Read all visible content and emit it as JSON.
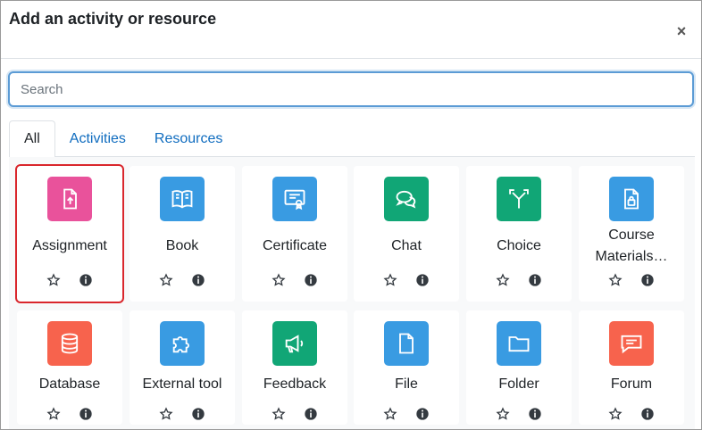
{
  "modal": {
    "title": "Add an activity or resource",
    "close_label": "×"
  },
  "search": {
    "placeholder": "Search",
    "value": ""
  },
  "tabs": [
    {
      "label": "All",
      "active": true
    },
    {
      "label": "Activities",
      "active": false
    },
    {
      "label": "Resources",
      "active": false
    }
  ],
  "items": [
    {
      "label": "Assignment",
      "icon": "assignment-upload-icon",
      "color": "#e9529b",
      "selected": true
    },
    {
      "label": "Book",
      "icon": "book-icon",
      "color": "#399be2"
    },
    {
      "label": "Certificate",
      "icon": "certificate-icon",
      "color": "#399be2"
    },
    {
      "label": "Chat",
      "icon": "chat-icon",
      "color": "#11a676"
    },
    {
      "label": "Choice",
      "icon": "choice-icon",
      "color": "#11a676"
    },
    {
      "label": "Course Materials…",
      "icon": "locked-document-icon",
      "color": "#399be2"
    },
    {
      "label": "Database",
      "icon": "database-icon",
      "color": "#f7634d"
    },
    {
      "label": "External tool",
      "icon": "puzzle-icon",
      "color": "#399be2"
    },
    {
      "label": "Feedback",
      "icon": "megaphone-icon",
      "color": "#11a676"
    },
    {
      "label": "File",
      "icon": "file-icon",
      "color": "#399be2"
    },
    {
      "label": "Folder",
      "icon": "folder-icon",
      "color": "#399be2"
    },
    {
      "label": "Forum",
      "icon": "forum-icon",
      "color": "#f7634d"
    }
  ]
}
